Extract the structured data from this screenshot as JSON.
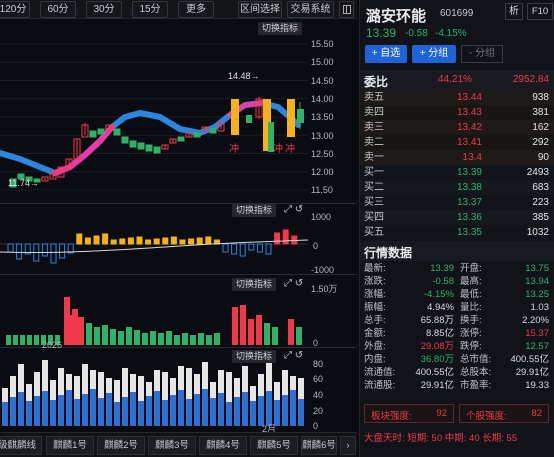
{
  "toolbar": {
    "periods": [
      "120分",
      "60分",
      "30分",
      "15分",
      "更多"
    ],
    "range_select": "区间选择",
    "trade_system": "交易系统"
  },
  "main_chart": {
    "switch_label": "切换指标",
    "axis": [
      "15.50",
      "15.00",
      "14.50",
      "14.00",
      "13.50",
      "13.00",
      "12.50",
      "12.00",
      "11.50"
    ],
    "max_label": "14.48→",
    "min_label": "11.74→",
    "chong": "冲",
    "colors": {
      "up": "#f0394a",
      "down": "#2fb268",
      "bull": "#f7b21a",
      "ma_blue": "#2c86e0",
      "ma_pink": "#e83aa8"
    }
  },
  "macd": {
    "switch_label": "切换指标",
    "axis": [
      "1000",
      "0",
      "-1000"
    ],
    "icons": "⤢ ↺"
  },
  "volume": {
    "switch_label": "切换指标",
    "axis": [
      "1.50万",
      "0"
    ]
  },
  "ratio": {
    "switch_label": "切换指标",
    "axis": [
      "80",
      "60",
      "40",
      "20",
      "0"
    ],
    "date_2026": "2026",
    "date_feb": "2月"
  },
  "bottom_tabs": [
    "级麒麟线",
    "麒麟1号",
    "麒麟2号",
    "麒麟3号",
    "麒麟4号",
    "麒麟5号",
    "麒麟6号"
  ],
  "stock": {
    "name": "潞安环能",
    "code": "601699",
    "btn_analysis": "析",
    "btn_f10": "F10",
    "price": "13.39",
    "change": "-0.58",
    "change_pct": "-4.15%",
    "add_fav": "+ 自选",
    "add_group": "+ 分组",
    "sub_group": "- 分组"
  },
  "orderbook": {
    "weibi_label": "委比",
    "weibi_pct": "44.21%",
    "weicha": "2952.84",
    "sells": [
      {
        "label": "卖五",
        "price": "13.44",
        "vol": "938"
      },
      {
        "label": "卖四",
        "price": "13.43",
        "vol": "381"
      },
      {
        "label": "卖三",
        "price": "13.42",
        "vol": "162"
      },
      {
        "label": "卖二",
        "price": "13.41",
        "vol": "292"
      },
      {
        "label": "卖一",
        "price": "13.4",
        "vol": "90"
      }
    ],
    "buys": [
      {
        "label": "买一",
        "price": "13.39",
        "vol": "2493"
      },
      {
        "label": "买二",
        "price": "13.38",
        "vol": "683"
      },
      {
        "label": "买三",
        "price": "13.37",
        "vol": "223"
      },
      {
        "label": "买四",
        "price": "13.36",
        "vol": "385"
      },
      {
        "label": "买五",
        "price": "13.35",
        "vol": "1032"
      }
    ]
  },
  "quote": {
    "title": "行情数据",
    "rows": [
      {
        "a": "最新:",
        "b": "13.39",
        "c": "开盘:",
        "d": "13.75"
      },
      {
        "a": "涨跌:",
        "b": "-0.58",
        "c": "最高:",
        "d": "13.94"
      },
      {
        "a": "涨幅:",
        "b": "-4.15%",
        "c": "最低:",
        "d": "13.25"
      },
      {
        "a": "振幅:",
        "b": "4.94%",
        "c": "量比:",
        "d": "1.03"
      },
      {
        "a": "总手:",
        "b": "65.88万",
        "c": "换手:",
        "d": "2.20%"
      },
      {
        "a": "金额:",
        "b": "8.85亿",
        "c": "涨停:",
        "d": "15.37"
      },
      {
        "a": "外盘:",
        "b": "29.08万",
        "c": "跌停:",
        "d": "12.57"
      },
      {
        "a": "内盘:",
        "b": "36.80万",
        "c": "总市值:",
        "d": "400.55亿"
      },
      {
        "a": "流通值:",
        "b": "400.55亿",
        "c": "总股本:",
        "d": "29.91亿"
      },
      {
        "a": "流通股:",
        "b": "29.91亿",
        "c": "市盈率:",
        "d": "19.33"
      }
    ]
  },
  "strength": {
    "block_label": "板块强度:",
    "block_val": "92",
    "stock_label": "个股强度:",
    "stock_val": "82"
  },
  "market_days": {
    "label": "大盘天时:",
    "short": "短期: 50",
    "mid": "中期: 40",
    "long": "长期: 55"
  }
}
